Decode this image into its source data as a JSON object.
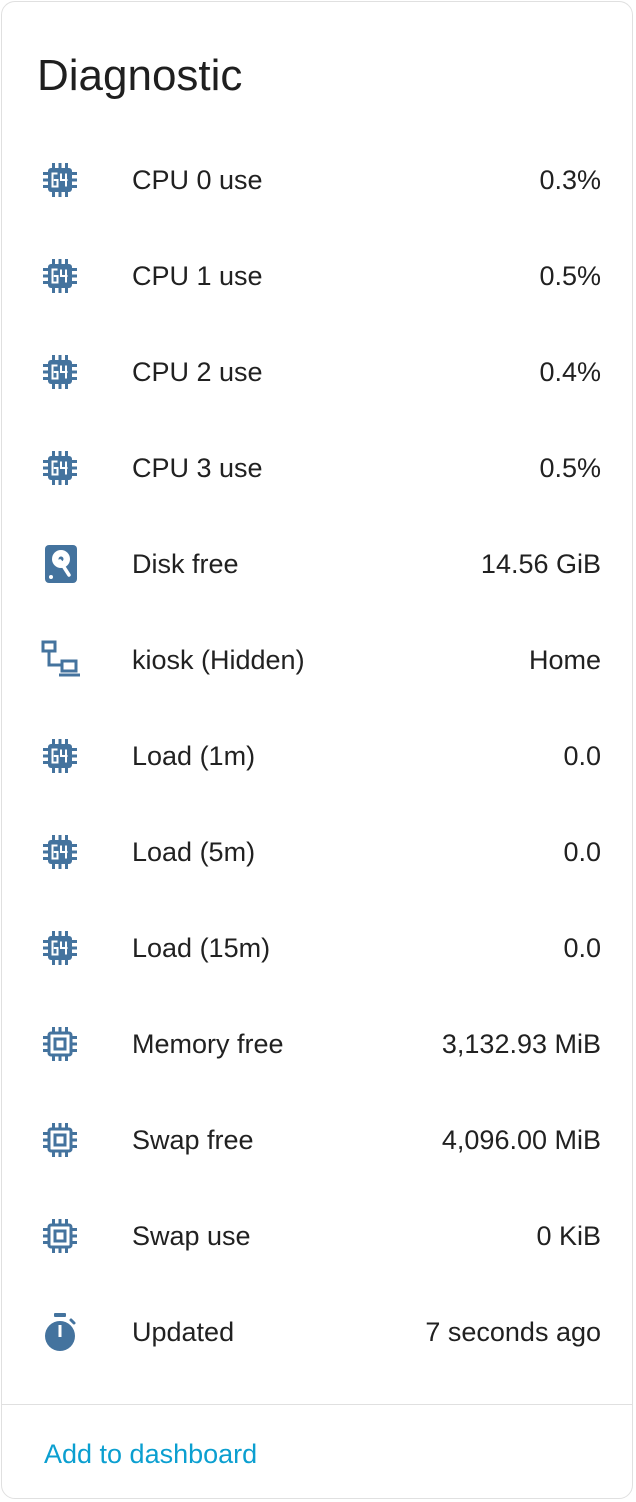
{
  "card": {
    "title": "Diagnostic",
    "icon_color": "#44739e",
    "link_color": "#0b9fd0",
    "rows": [
      {
        "icon": "cpu-64-bit-icon",
        "label": "CPU 0 use",
        "value": "0.3%"
      },
      {
        "icon": "cpu-64-bit-icon",
        "label": "CPU 1 use",
        "value": "0.5%"
      },
      {
        "icon": "cpu-64-bit-icon",
        "label": "CPU 2 use",
        "value": "0.4%"
      },
      {
        "icon": "cpu-64-bit-icon",
        "label": "CPU 3 use",
        "value": "0.5%"
      },
      {
        "icon": "harddisk-icon",
        "label": "Disk free",
        "value": "14.56 GiB"
      },
      {
        "icon": "lan-icon",
        "label": "kiosk (Hidden)",
        "value": "Home"
      },
      {
        "icon": "cpu-64-bit-icon",
        "label": "Load (1m)",
        "value": "0.0"
      },
      {
        "icon": "cpu-64-bit-icon",
        "label": "Load (5m)",
        "value": "0.0"
      },
      {
        "icon": "cpu-64-bit-icon",
        "label": "Load (15m)",
        "value": "0.0"
      },
      {
        "icon": "memory-icon",
        "label": "Memory free",
        "value": "3,132.93 MiB"
      },
      {
        "icon": "memory-icon",
        "label": "Swap free",
        "value": "4,096.00 MiB"
      },
      {
        "icon": "memory-icon",
        "label": "Swap use",
        "value": "0 KiB"
      },
      {
        "icon": "timer-icon",
        "label": "Updated",
        "value": "7 seconds ago"
      }
    ],
    "footer": {
      "add_label": "Add to dashboard"
    }
  }
}
